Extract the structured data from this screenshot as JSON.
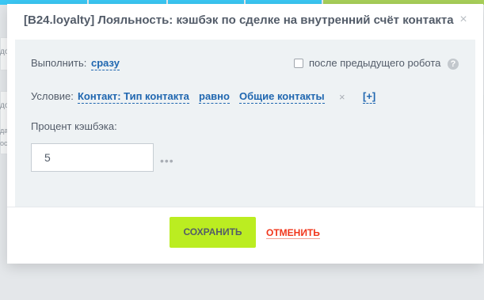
{
  "background": {
    "left_fragments": [
      "до",
      "до",
      "да",
      "ос"
    ],
    "right_fragments": [
      "ο",
      "ο"
    ]
  },
  "dialog": {
    "title": "[B24.loyalty] Лояльность: кэшбэк по сделке на внутренний счёт контакта",
    "close_glyph": "×",
    "execute": {
      "label": "Выполнить:",
      "value": "сразу"
    },
    "after_previous": {
      "checked": false,
      "label": "после предыдущего робота",
      "help_glyph": "?"
    },
    "condition": {
      "label": "Условие:",
      "field": "Контакт: Тип контакта",
      "operator": "равно",
      "value": "Общие контакты",
      "remove_glyph": "×",
      "add_label": "[+]"
    },
    "cashback": {
      "label": "Процент кэшбэка:",
      "value": "5",
      "more_glyph": "•••"
    },
    "buttons": {
      "save": "СОХРАНИТЬ",
      "cancel": "ОТМЕНИТЬ"
    }
  },
  "colors": {
    "accent_green": "#bbed21",
    "link_blue": "#2067b0",
    "cancel_red": "#f1361b"
  }
}
